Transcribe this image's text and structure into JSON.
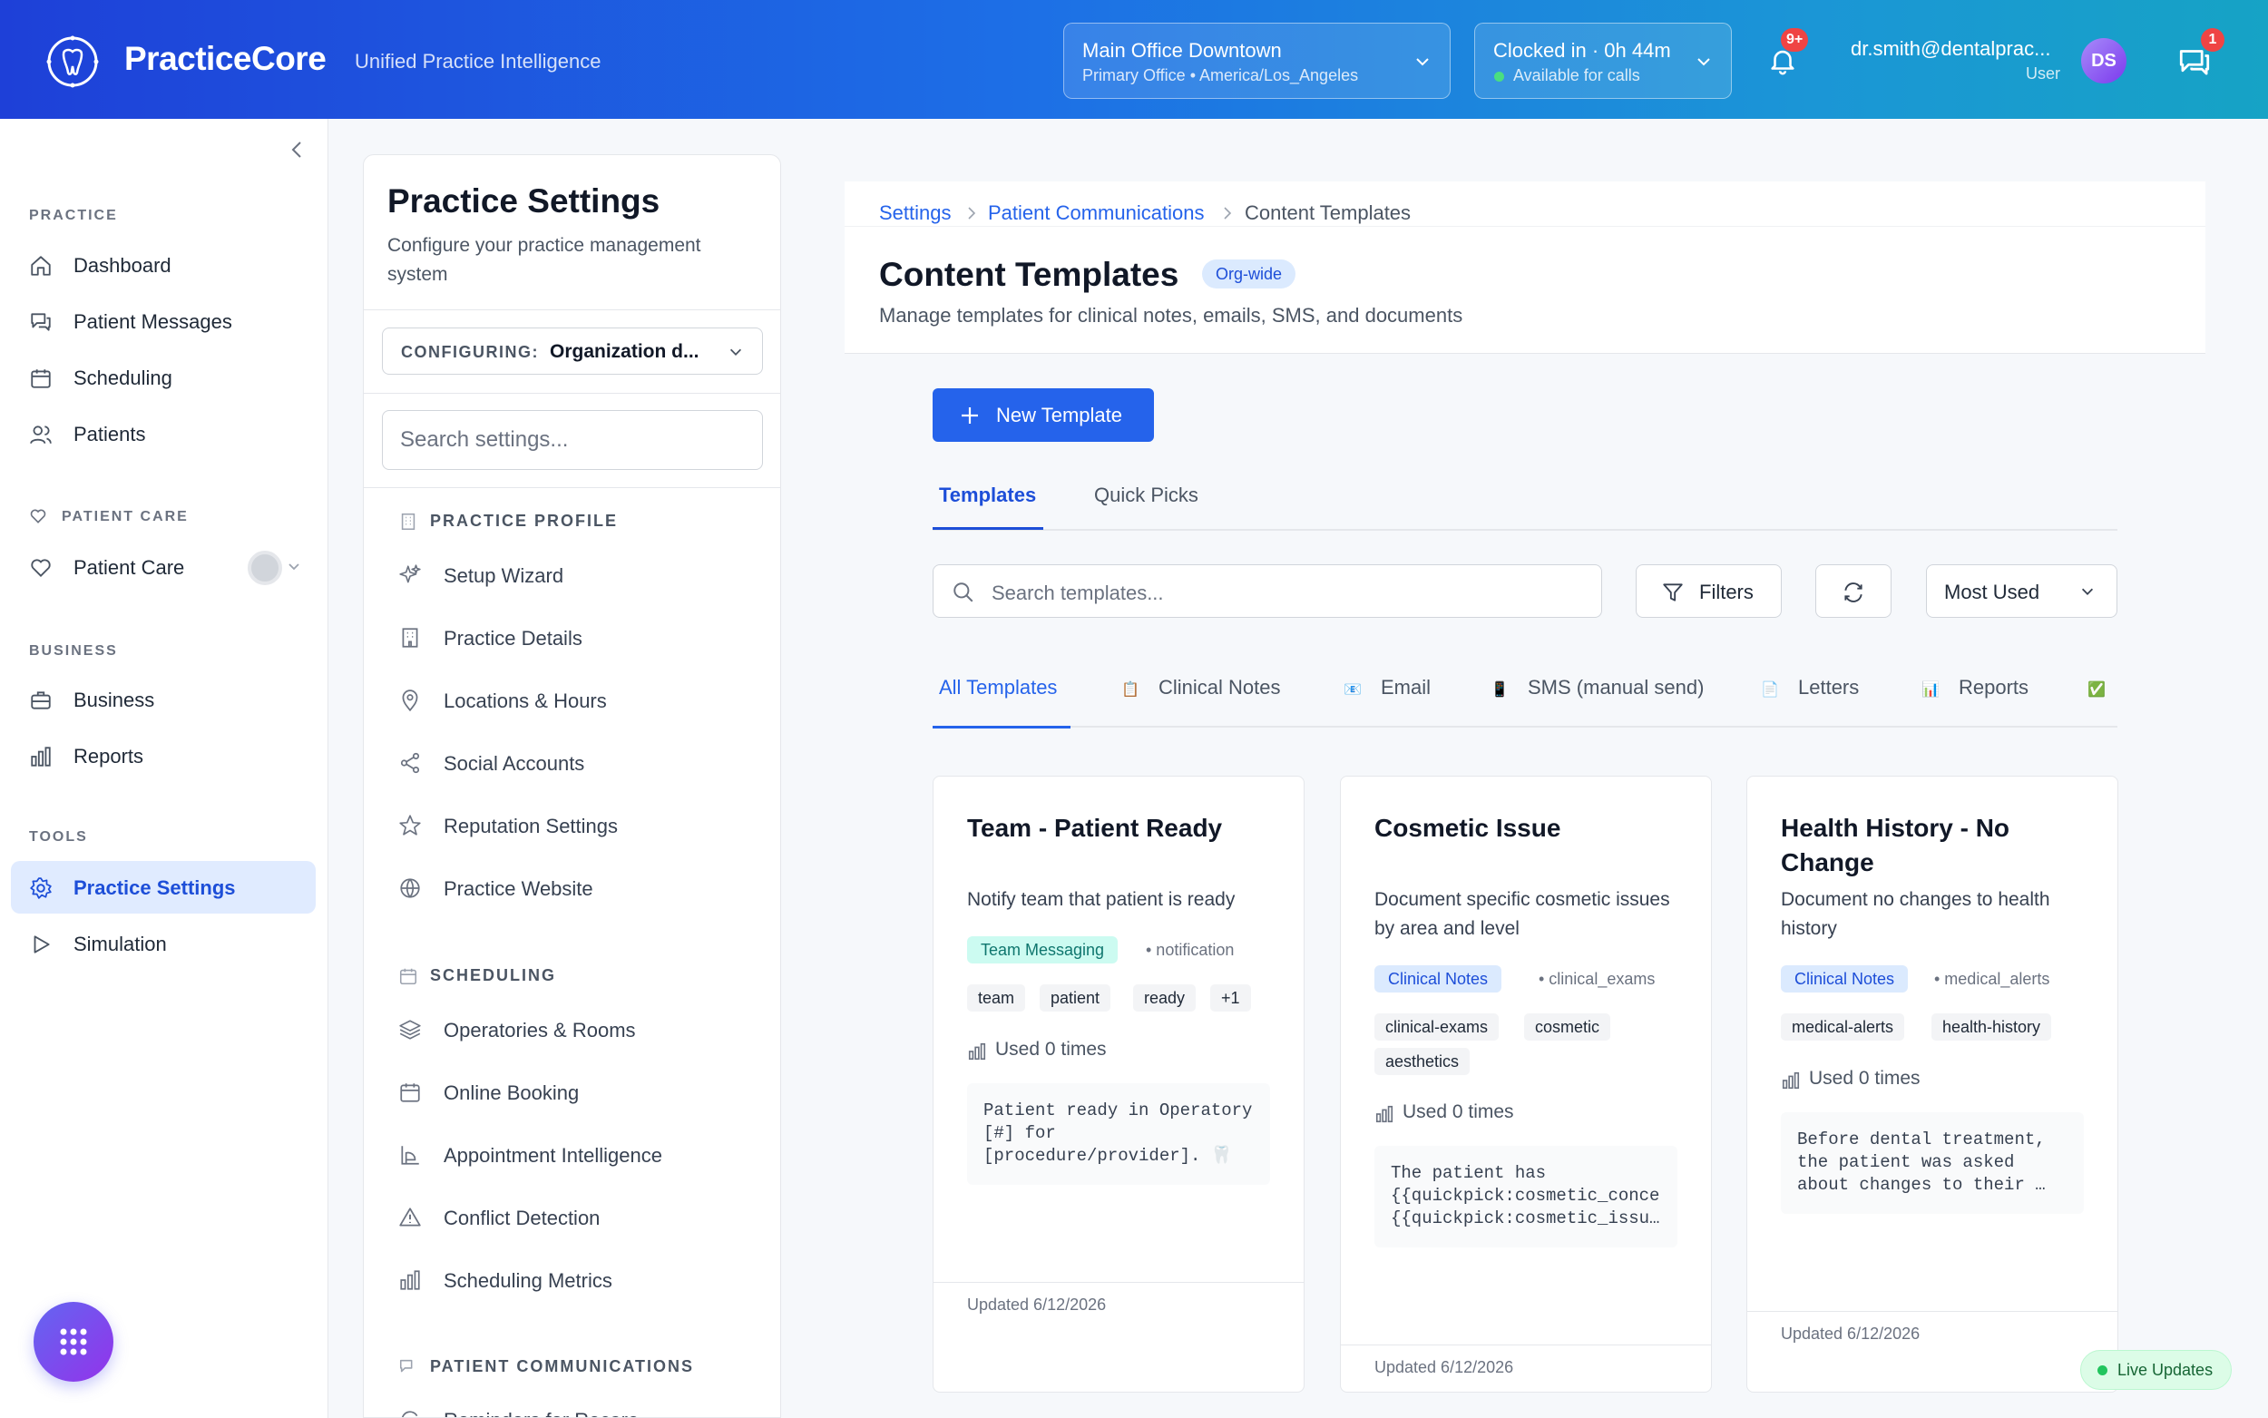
{
  "app": {
    "name": "PracticeCore",
    "tagline": "Unified Practice Intelligence"
  },
  "location": {
    "name": "Main Office Downtown",
    "detail": "Primary Office • America/Los_Angeles"
  },
  "clock": {
    "status": "Clocked in · 0h 44m",
    "availability": "Available for calls"
  },
  "notifications": {
    "count": "9+"
  },
  "user": {
    "email": "dr.smith@dentalprac...",
    "role": "User",
    "initials": "DS"
  },
  "messages": {
    "count": "1"
  },
  "sidebar": {
    "sections": [
      {
        "title": "PRACTICE",
        "items": [
          "Dashboard",
          "Patient Messages",
          "Scheduling",
          "Patients"
        ]
      },
      {
        "title": "PATIENT CARE",
        "items": [
          "Patient Care"
        ]
      },
      {
        "title": "BUSINESS",
        "items": [
          "Business",
          "Reports"
        ]
      },
      {
        "title": "TOOLS",
        "items": [
          "Practice Settings",
          "Simulation"
        ]
      }
    ],
    "active": "Practice Settings"
  },
  "settings_panel": {
    "title": "Practice Settings",
    "description": "Configure your practice management system",
    "configuring_label": "CONFIGURING:",
    "configuring_value": "Organization d...",
    "search_placeholder": "Search settings...",
    "groups": [
      {
        "title": "PRACTICE PROFILE",
        "items": [
          "Setup Wizard",
          "Practice Details",
          "Locations & Hours",
          "Social Accounts",
          "Reputation Settings",
          "Practice Website"
        ]
      },
      {
        "title": "SCHEDULING",
        "items": [
          "Operatories & Rooms",
          "Online Booking",
          "Appointment Intelligence",
          "Conflict Detection",
          "Scheduling Metrics"
        ]
      },
      {
        "title": "PATIENT COMMUNICATIONS",
        "items": [
          "Reminders for Recare"
        ]
      }
    ]
  },
  "page": {
    "breadcrumb": [
      "Settings",
      "Patient Communications",
      "Content Templates"
    ],
    "title": "Content Templates",
    "scope_badge": "Org-wide",
    "description": "Manage templates for clinical notes, emails, SMS, and documents",
    "new_button": "New Template",
    "tabs": [
      "Templates",
      "Quick Picks"
    ],
    "active_tab": "Templates",
    "search_placeholder": "Search templates...",
    "filters_label": "Filters",
    "sort_value": "Most Used",
    "categories": [
      {
        "label": "All Templates",
        "emoji": ""
      },
      {
        "label": "Clinical Notes",
        "emoji": "📋"
      },
      {
        "label": "Email",
        "emoji": "📧"
      },
      {
        "label": "SMS (manual send)",
        "emoji": "📱"
      },
      {
        "label": "Letters",
        "emoji": "📄"
      },
      {
        "label": "Reports",
        "emoji": "📊"
      },
      {
        "label": "",
        "emoji": "✅"
      }
    ],
    "active_category": "All Templates"
  },
  "templates": [
    {
      "title": "Team - Patient Ready",
      "description": "Notify team that patient is ready",
      "category": "Team Messaging",
      "subcategory": "• notification",
      "tags": [
        "team",
        "patient",
        "ready",
        "+1"
      ],
      "used": "Used 0 times",
      "preview": "Patient ready in Operatory [#] for [procedure/provider]. 🦷",
      "updated": "Updated 6/12/2026"
    },
    {
      "title": "Cosmetic Issue",
      "description": "Document specific cosmetic issues by area and level",
      "category": "Clinical Notes",
      "subcategory": "• clinical_exams",
      "tags": [
        "clinical-exams",
        "cosmetic",
        "aesthetics"
      ],
      "used": "Used 0 times",
      "preview": "The patient has {{quickpick:cosmetic_conce {{quickpick:cosmetic_issu…",
      "updated": "Updated 6/12/2026"
    },
    {
      "title": "Health History - No Change",
      "description": "Document no changes to health history",
      "category": "Clinical Notes",
      "subcategory": "• medical_alerts",
      "tags": [
        "medical-alerts",
        "health-history"
      ],
      "used": "Used 0 times",
      "preview": "Before dental treatment, the patient was asked about changes to their …",
      "updated": "Updated 6/12/2026"
    }
  ],
  "live_updates": "Live Updates",
  "colors": {
    "primary": "#2563eb",
    "accent_teal": "#16a3c5",
    "alert": "#ef4444",
    "badge_teal_bg": "#ccfbf1",
    "badge_blue_bg": "#dbeafe"
  }
}
